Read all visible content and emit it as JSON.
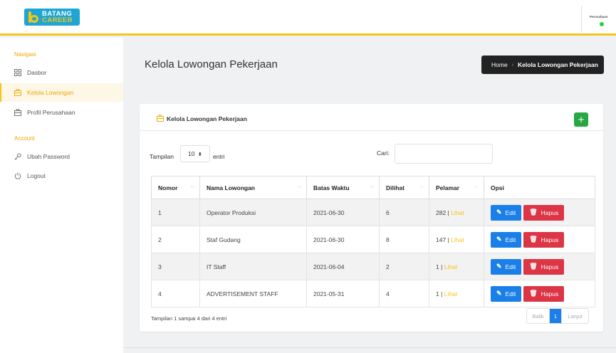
{
  "app": {
    "logo_line1": "BATANG",
    "logo_line2": "CAREER",
    "user_name": "Perusahaan"
  },
  "sidebar": {
    "heading_nav": "Navigasi",
    "heading_account": "Account",
    "items": [
      {
        "label": "Dasbor",
        "icon": "grid-icon"
      },
      {
        "label": "Kelola Lowongan",
        "icon": "briefcase-icon",
        "active": true
      },
      {
        "label": "Profil Perusahaan",
        "icon": "building-icon"
      },
      {
        "label": "Ubah Password",
        "icon": "key-icon"
      },
      {
        "label": "Logout",
        "icon": "power-icon"
      }
    ]
  },
  "page": {
    "title": "Kelola Lowongan Pekerjaan",
    "breadcrumb_home": "Home",
    "breadcrumb_current": "Kelola Lowongan Pekerjaan"
  },
  "card": {
    "title": "Kelola Lowongan Pekerjaan",
    "add_label": "+",
    "length_label": "Tampilan",
    "length_value": "10",
    "length_suffix": "entri",
    "search_label": "Cari:",
    "search_value": ""
  },
  "table": {
    "headers": [
      "Nomor",
      "Nama Lowongan",
      "Batas Waktu",
      "Dilihat",
      "Pelamar",
      "Opsi"
    ],
    "rows": [
      {
        "no": "1",
        "nama": "Operator Produksi",
        "batas": "2021-06-30",
        "dilihat": "6",
        "pelamar": "282 |",
        "lihat": "Lihat"
      },
      {
        "no": "2",
        "nama": "Staf Gudang",
        "batas": "2021-06-30",
        "dilihat": "8",
        "pelamar": "147 |",
        "lihat": "Lihat"
      },
      {
        "no": "3",
        "nama": "IT Staff",
        "batas": "2021-06-04",
        "dilihat": "2",
        "pelamar": "1 |",
        "lihat": "Lihat"
      },
      {
        "no": "4",
        "nama": "ADVERTISEMENT STAFF",
        "batas": "2021-05-31",
        "dilihat": "4",
        "pelamar": "1 |",
        "lihat": "Lihat"
      }
    ],
    "edit_label": "Edit",
    "delete_label": "Hapus"
  },
  "footer": {
    "info": "Tampilan 1 sampai 4 dari 4 entri",
    "prev": "Balik",
    "current_page": "1",
    "next": "Lanjut"
  },
  "colors": {
    "accent": "#f5c518",
    "primary": "#1a7fe8",
    "danger": "#dc3545",
    "success": "#28a745"
  }
}
